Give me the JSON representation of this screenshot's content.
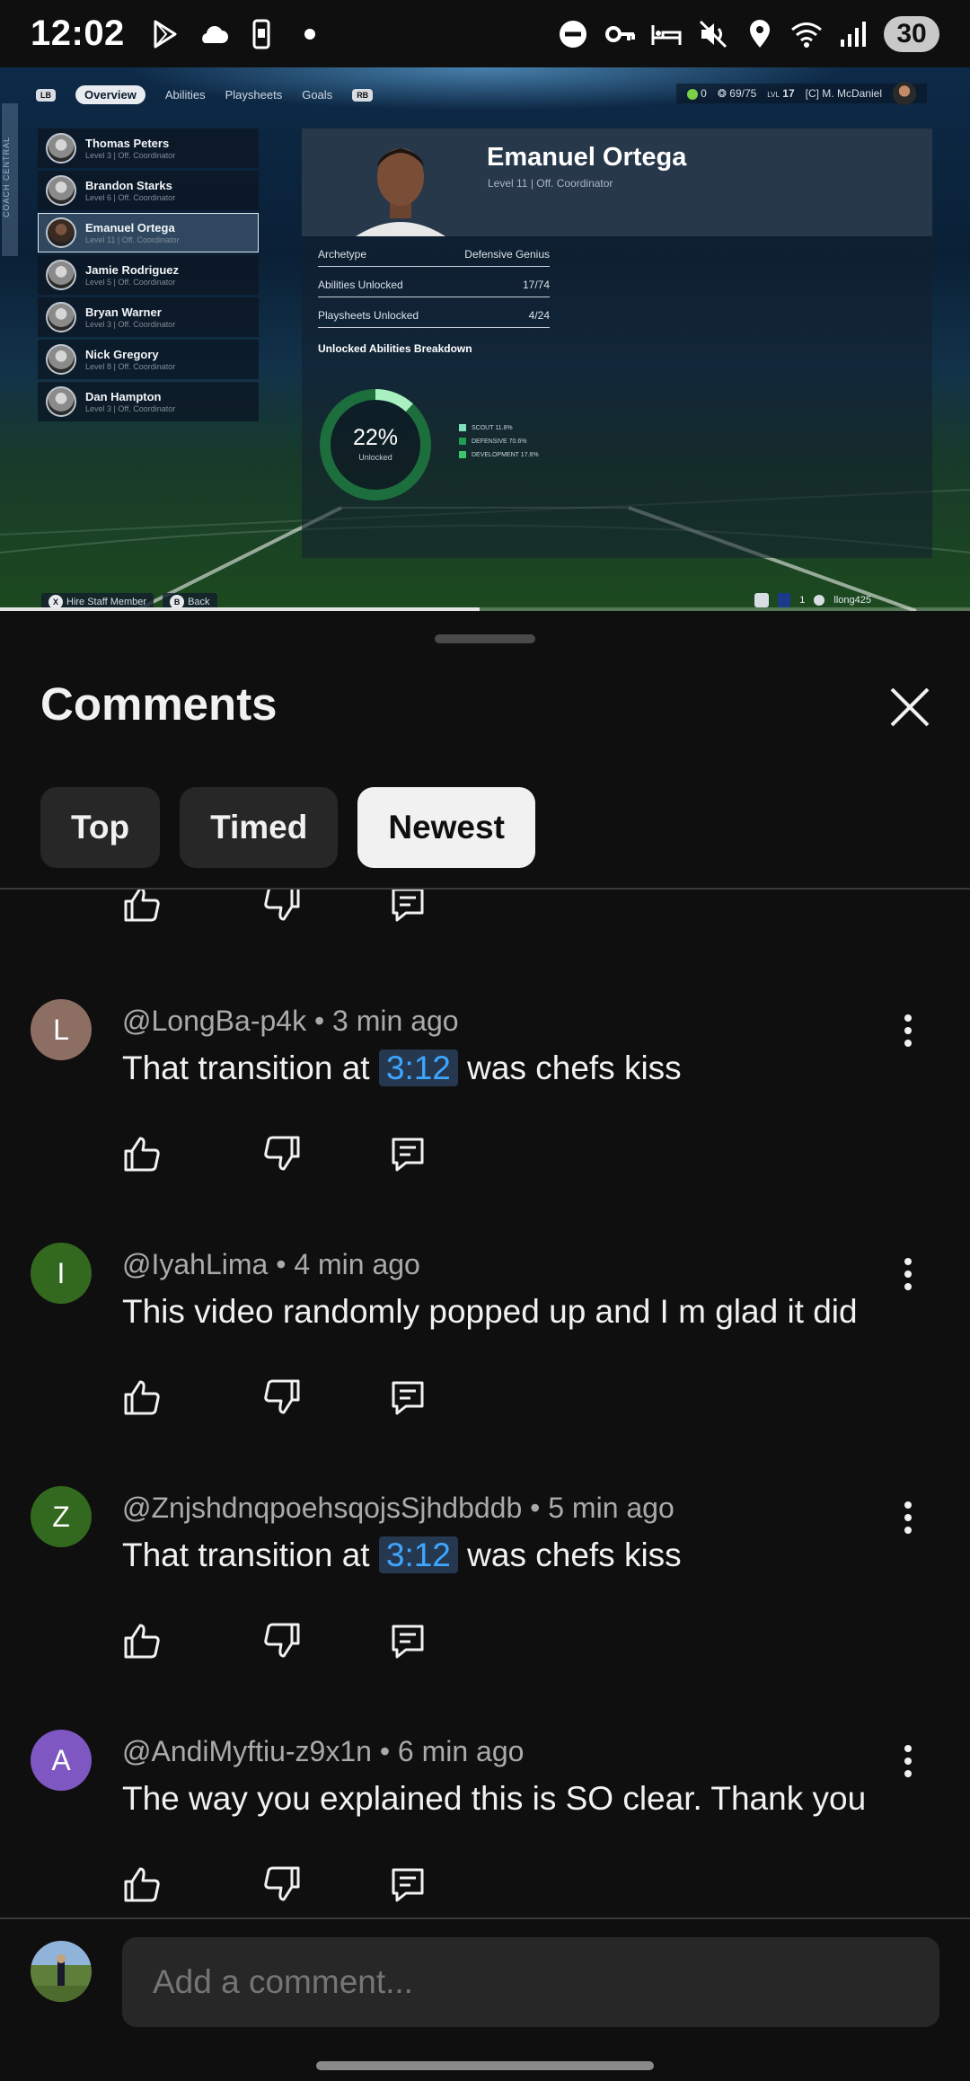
{
  "status_bar": {
    "time": "12:02",
    "battery": "30",
    "signal_label": "5",
    "left_icons": [
      "play-store-icon",
      "cloud-icon",
      "phone-icon",
      "dot-icon"
    ],
    "right_icons": [
      "dnd-icon",
      "vpn-key-icon",
      "bed-icon",
      "mute-icon",
      "location-icon",
      "wifi-icon",
      "signal-icon"
    ]
  },
  "video": {
    "progress": 0.494,
    "game": {
      "nav": {
        "lb": "LB",
        "rb": "RB",
        "tabs": [
          "Overview",
          "Abilities",
          "Playsheets",
          "Goals"
        ],
        "active_tab": "Overview"
      },
      "sidebar_label": "COACH CENTRAL",
      "hud": {
        "points": "0",
        "xp": "69/75",
        "level_prefix": "LVL",
        "level": "17",
        "coach": "[C] M. McDaniel"
      },
      "staff": [
        {
          "name": "Thomas Peters",
          "sub": "Level 3 | Off. Coordinator"
        },
        {
          "name": "Brandon Starks",
          "sub": "Level 6 | Off. Coordinator"
        },
        {
          "name": "Emanuel Ortega",
          "sub": "Level 11 | Off. Coordinator"
        },
        {
          "name": "Jamie Rodriguez",
          "sub": "Level 5 | Off. Coordinator"
        },
        {
          "name": "Bryan Warner",
          "sub": "Level 3 | Off. Coordinator"
        },
        {
          "name": "Nick Gregory",
          "sub": "Level 8 | Off. Coordinator"
        },
        {
          "name": "Dan Hampton",
          "sub": "Level 3 | Off. Coordinator"
        }
      ],
      "selected_index": 2,
      "profile": {
        "name": "Emanuel Ortega",
        "sub": "Level 11 | Off. Coordinator",
        "rows": [
          {
            "label": "Archetype",
            "value": "Defensive Genius"
          },
          {
            "label": "Abilities Unlocked",
            "value": "17/74"
          },
          {
            "label": "Playsheets Unlocked",
            "value": "4/24"
          }
        ],
        "breakdown_title": "Unlocked Abilities Breakdown",
        "donut_percent": "22%",
        "donut_label": "Unlocked",
        "legend": [
          {
            "label": "SCOUT 11.8%",
            "color": "#7fe0c0",
            "value": 11.8
          },
          {
            "label": "DEFENSIVE 70.6%",
            "color": "#1e9e54",
            "value": 70.6
          },
          {
            "label": "DEVELOPMENT 17.6%",
            "color": "#3cc46f",
            "value": 17.6
          }
        ]
      },
      "footer": {
        "x_label": "Hire Staff Member",
        "b_label": "Back",
        "x_glyph": "X",
        "b_glyph": "B",
        "right_count": "1",
        "gamertag": "llong425"
      }
    }
  },
  "comments_sheet": {
    "title": "Comments",
    "chips": [
      {
        "label": "Top",
        "active": false
      },
      {
        "label": "Timed",
        "active": false
      },
      {
        "label": "Newest",
        "active": true
      }
    ],
    "comments": [
      {
        "initial": "L",
        "avatar_color": "#8d6e63",
        "author": "@LongBa-p4k",
        "time": "3 min ago",
        "before": "That transition at ",
        "timestamp": "3:12",
        "after": " was chefs kiss"
      },
      {
        "initial": "I",
        "avatar_color": "#33691e",
        "author": "@IyahLima",
        "time": "4 min ago",
        "before": "This video randomly popped up and I m glad it did",
        "timestamp": "",
        "after": ""
      },
      {
        "initial": "Z",
        "avatar_color": "#33691e",
        "author": "@ZnjshdnqpoehsqojsSjhdbddb",
        "time": "5 min ago",
        "before": "That transition at ",
        "timestamp": "3:12",
        "after": " was chefs kiss"
      },
      {
        "initial": "A",
        "avatar_color": "#7e57c2",
        "author": "@AndiMyftiu-z9x1n",
        "time": "6 min ago",
        "before": "The way you explained this is SO clear. Thank you",
        "timestamp": "",
        "after": ""
      }
    ],
    "composer_placeholder": "Add a comment..."
  },
  "colors": {
    "accent_link": "#3ea6ff",
    "background": "#0f0f0f",
    "chip_bg": "#272727"
  }
}
